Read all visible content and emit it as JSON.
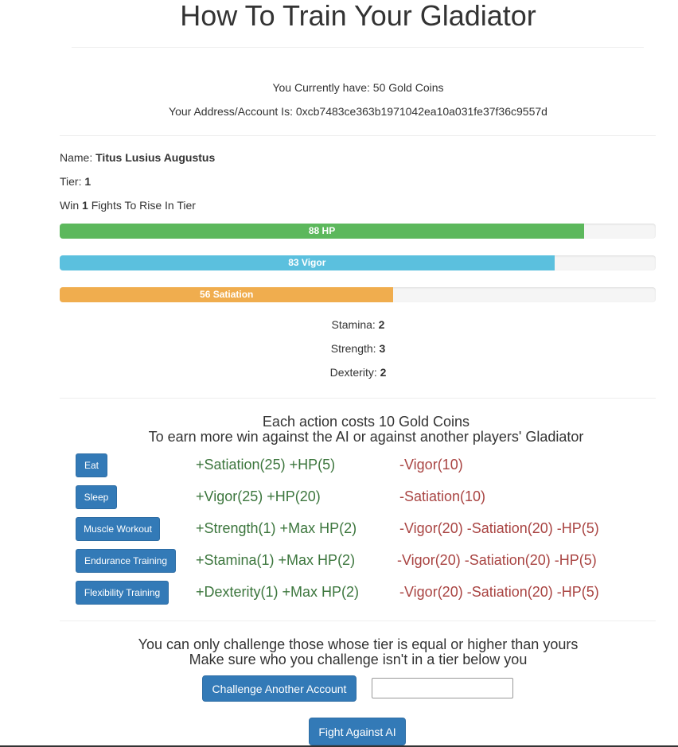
{
  "title": "How To Train Your Gladiator",
  "account": {
    "gold_text": "You Currently have: 50 Gold Coins",
    "address_text": "Your Address/Account Is: 0xcb7483ce363b1971042ea10a031fe37f36c9557d"
  },
  "gladiator": {
    "name_label": "Name:",
    "name": "Titus Lusius Augustus",
    "tier_label": "Tier:",
    "tier": "1",
    "win_prefix": "Win",
    "wins_needed": "1",
    "win_suffix": "Fights To Rise In Tier"
  },
  "bars": [
    {
      "label": "88 HP",
      "value": 88,
      "max": 100,
      "color": "#5cb85c"
    },
    {
      "label": "83 Vigor",
      "value": 83,
      "max": 100,
      "color": "#5bc0de"
    },
    {
      "label": "56 Satiation",
      "value": 56,
      "max": 100,
      "color": "#f0ad4e"
    }
  ],
  "stats": {
    "stamina_label": "Stamina:",
    "stamina": "2",
    "strength_label": "Strength:",
    "strength": "3",
    "dexterity_label": "Dexterity:",
    "dexterity": "2"
  },
  "actions_info": {
    "line1": "Each action costs 10 Gold Coins",
    "line2": "To earn more win against the AI or against another players' Gladiator"
  },
  "actions": [
    {
      "label": "Eat",
      "gain": "+Satiation(25) +HP(5)",
      "cost": "-Vigor(10)"
    },
    {
      "label": "Sleep",
      "gain": "+Vigor(25) +HP(20)",
      "cost": "-Satiation(10)"
    },
    {
      "label": "Muscle Workout",
      "gain": "+Strength(1) +Max HP(2)",
      "cost": "-Vigor(20) -Satiation(20) -HP(5)"
    },
    {
      "label": "Endurance Training",
      "gain": "+Stamina(1) +Max HP(2)",
      "cost": "-Vigor(20) -Satiation(20) -HP(5)"
    },
    {
      "label": "Flexibility Training",
      "gain": "+Dexterity(1) +Max HP(2)",
      "cost": "-Vigor(20) -Satiation(20) -HP(5)"
    }
  ],
  "challenge": {
    "line1": "You can only challenge those whose tier is equal or higher than yours",
    "line2": "Make sure who you challenge isn't in a tier below you",
    "button_label": "Challenge Another Account",
    "input_value": "",
    "ai_button_label": "Fight Against AI"
  }
}
